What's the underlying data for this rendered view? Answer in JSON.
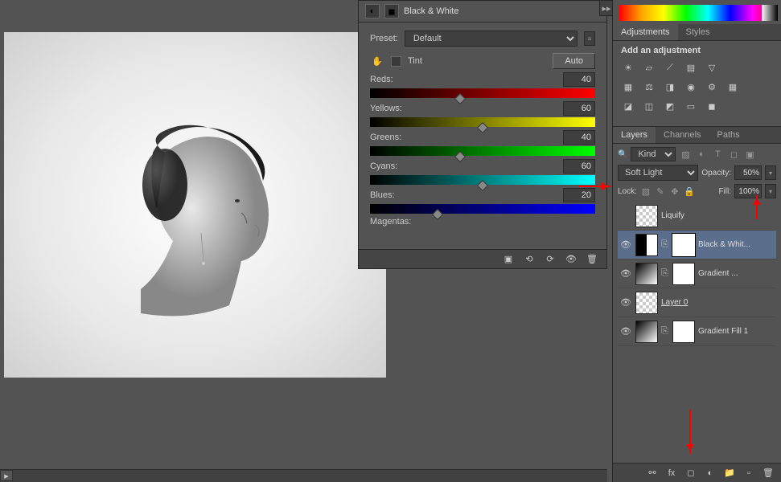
{
  "properties": {
    "title": "Black & White",
    "preset_label": "Preset:",
    "preset_value": "Default",
    "tint_label": "Tint",
    "auto_label": "Auto",
    "sliders": {
      "reds": {
        "label": "Reds:",
        "value": "40",
        "pos": 40
      },
      "yellows": {
        "label": "Yellows:",
        "value": "60",
        "pos": 50
      },
      "greens": {
        "label": "Greens:",
        "value": "40",
        "pos": 40
      },
      "cyans": {
        "label": "Cyans:",
        "value": "60",
        "pos": 50
      },
      "blues": {
        "label": "Blues:",
        "value": "20",
        "pos": 30
      },
      "magentas": {
        "label": "Magentas:"
      }
    }
  },
  "adjustments": {
    "tab1": "Adjustments",
    "tab2": "Styles",
    "title": "Add an adjustment"
  },
  "layers_panel": {
    "tab1": "Layers",
    "tab2": "Channels",
    "tab3": "Paths",
    "kind_label": "Kind",
    "blend_mode": "Soft Light",
    "opacity_label": "Opacity:",
    "opacity_value": "50%",
    "lock_label": "Lock:",
    "fill_label": "Fill:",
    "fill_value": "100%"
  },
  "layers": [
    {
      "name": "Liquify",
      "visible": false
    },
    {
      "name": "Black & Whit...",
      "visible": true,
      "selected": true
    },
    {
      "name": "Gradient ...",
      "visible": true
    },
    {
      "name": "Layer 0",
      "visible": true,
      "underline": true
    },
    {
      "name": "Gradient Fill 1",
      "visible": true
    }
  ]
}
